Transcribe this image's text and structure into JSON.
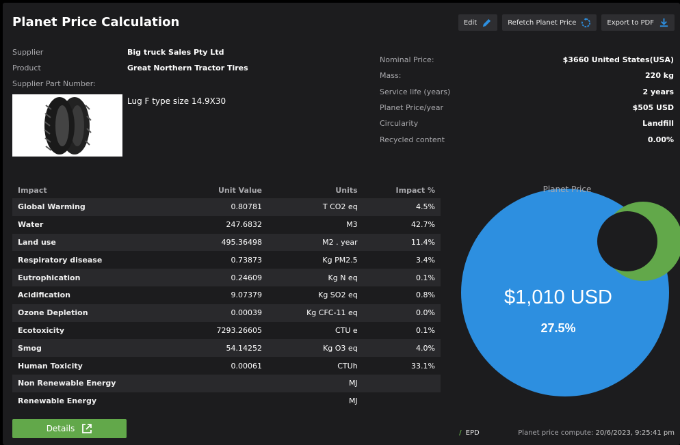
{
  "header": {
    "title": "Planet Price Calculation",
    "edit_label": "Edit",
    "refetch_label": "Refetch Planet Price",
    "export_label": "Export to PDF"
  },
  "supplier_info": {
    "supplier_label": "Supplier",
    "supplier_value": "Big truck Sales Pty Ltd",
    "product_label": "Product",
    "product_value": "Great Northern Tractor Tires",
    "part_number_label": "Supplier Part Number:",
    "part_description": "Lug F type size 14.9X30"
  },
  "summary": [
    {
      "label": "Nominal Price:",
      "value": "$3660 United States(USA)"
    },
    {
      "label": "Mass:",
      "value": "220 kg"
    },
    {
      "label": "Service life (years)",
      "value": "2 years"
    },
    {
      "label": "Planet Price/year",
      "value": "$505 USD"
    },
    {
      "label": "Circularity",
      "value": "Landfill"
    },
    {
      "label": "Recycled content",
      "value": "0.00%"
    }
  ],
  "impact_table": {
    "headers": [
      "Impact",
      "Unit Value",
      "Units",
      "Impact %"
    ],
    "rows": [
      [
        "Global Warming",
        "0.80781",
        "T CO2 eq",
        "4.5%"
      ],
      [
        "Water",
        "247.6832",
        "M3",
        "42.7%"
      ],
      [
        "Land use",
        "495.36498",
        "M2 . year",
        "11.4%"
      ],
      [
        "Respiratory disease",
        "0.73873",
        "Kg PM2.5",
        "3.4%"
      ],
      [
        "Eutrophication",
        "0.24609",
        "Kg N eq",
        "0.1%"
      ],
      [
        "Acidification",
        "9.07379",
        "Kg SO2 eq",
        "0.8%"
      ],
      [
        "Ozone Depletion",
        "0.00039",
        "Kg CFC-11 eq",
        "0.0%"
      ],
      [
        "Ecotoxicity",
        "7293.26605",
        "CTU e",
        "0.1%"
      ],
      [
        "Smog",
        "54.14252",
        "Kg O3 eq",
        "4.0%"
      ],
      [
        "Human Toxicity",
        "0.00061",
        "CTUh",
        "33.1%"
      ],
      [
        "Non Renewable Energy",
        "",
        "MJ",
        ""
      ],
      [
        "Renewable Energy",
        "",
        "MJ",
        ""
      ]
    ]
  },
  "details_label": "Details",
  "chart_data": {
    "type": "pie",
    "title": "Planet Price",
    "center_value": "$1,010 USD",
    "center_percent": "27.5%",
    "slices": [
      {
        "name": "",
        "value": 72.5,
        "color": "#2d8fe0"
      },
      {
        "name": "",
        "value": 27.5,
        "color": "#62a84a"
      }
    ]
  },
  "footer": {
    "epd_label": "EPD",
    "computed_label": "Planet price compute:",
    "computed_value": "20/6/2023, 9:25:41 pm"
  },
  "colors": {
    "background": "#1c1c1e",
    "accent_green": "#62a84a",
    "accent_blue": "#2d8fe0"
  },
  "icons": {
    "edit": "pencil-icon",
    "refetch": "refresh-icon",
    "export": "download-icon",
    "details": "external-link-icon"
  }
}
